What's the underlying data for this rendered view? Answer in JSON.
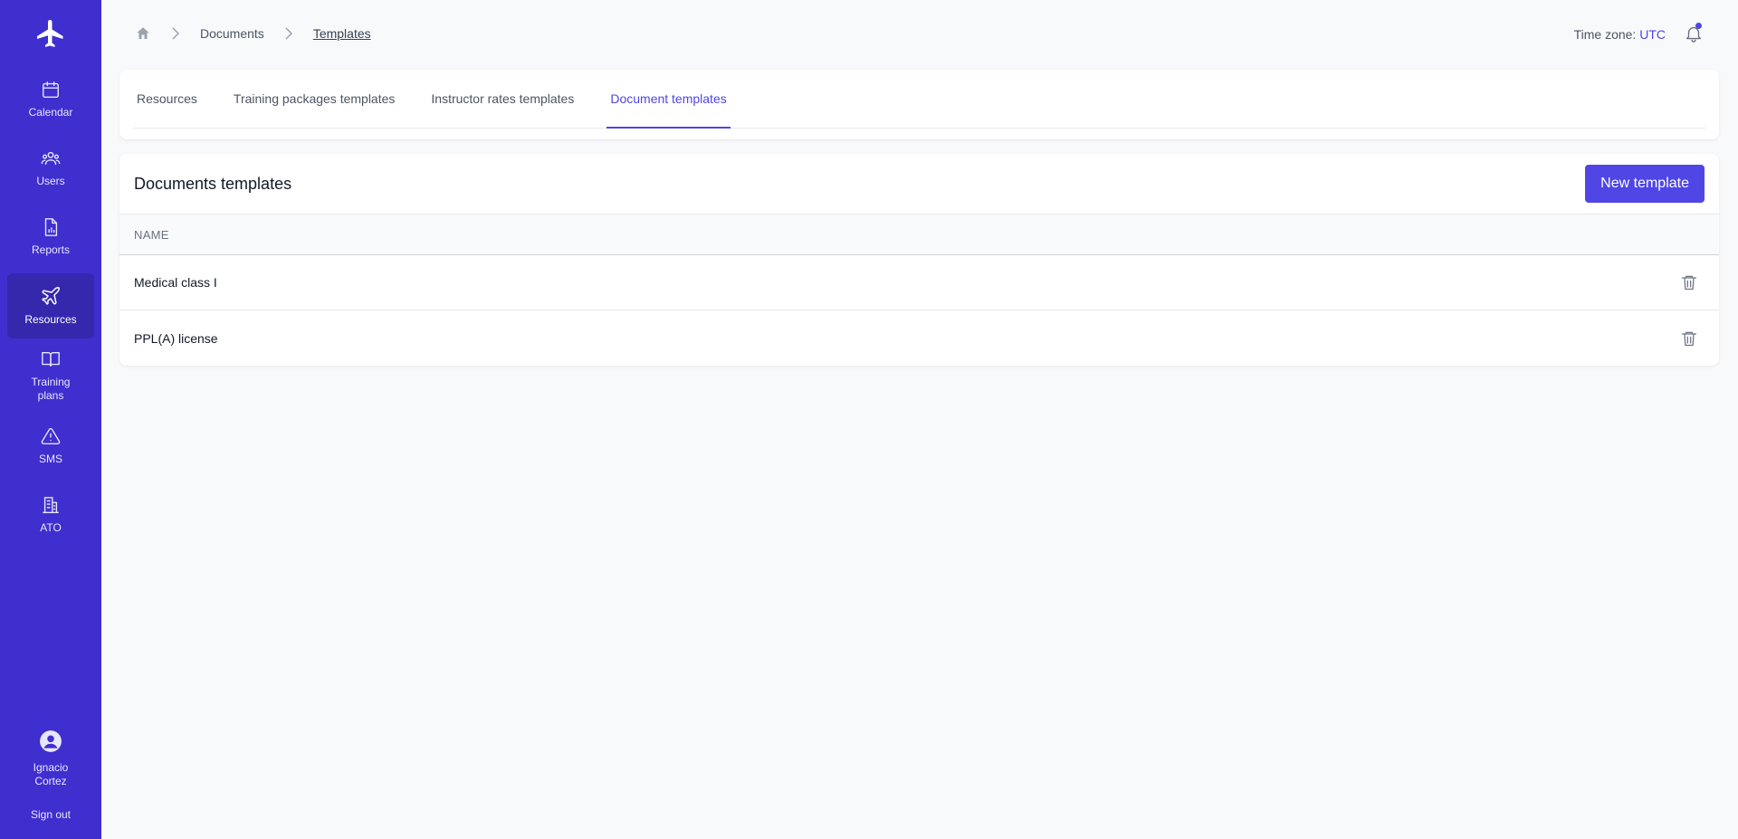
{
  "sidebar": {
    "logo_icon": "airplane-icon",
    "items": [
      {
        "label": "Calendar",
        "icon": "calendar-icon"
      },
      {
        "label": "Users",
        "icon": "users-icon"
      },
      {
        "label": "Reports",
        "icon": "report-icon"
      },
      {
        "label": "Resources",
        "icon": "airplane-outline-icon",
        "active": true
      },
      {
        "label": "Training plans",
        "icon": "book-icon"
      },
      {
        "label": "SMS",
        "icon": "warning-icon"
      },
      {
        "label": "ATO",
        "icon": "building-icon"
      }
    ],
    "user_name": "Ignacio Cortez",
    "sign_out": "Sign out"
  },
  "header": {
    "breadcrumb": {
      "home_icon": "home-icon",
      "items": [
        "Documents",
        "Templates"
      ]
    },
    "timezone_label": "Time zone:",
    "timezone_value": "UTC",
    "notification_icon": "bell-icon"
  },
  "tabs": [
    {
      "label": "Resources",
      "active": false
    },
    {
      "label": "Training packages templates",
      "active": false
    },
    {
      "label": "Instructor rates templates",
      "active": false
    },
    {
      "label": "Document templates",
      "active": true
    }
  ],
  "table": {
    "title": "Documents templates",
    "new_button": "New template",
    "columns": [
      "NAME"
    ],
    "rows": [
      {
        "name": "Medical class I"
      },
      {
        "name": "PPL(A) license"
      }
    ]
  },
  "colors": {
    "sidebar_bg": "#3f2fcf",
    "accent": "#4f46e5",
    "page_bg": "#f8f9fb"
  }
}
